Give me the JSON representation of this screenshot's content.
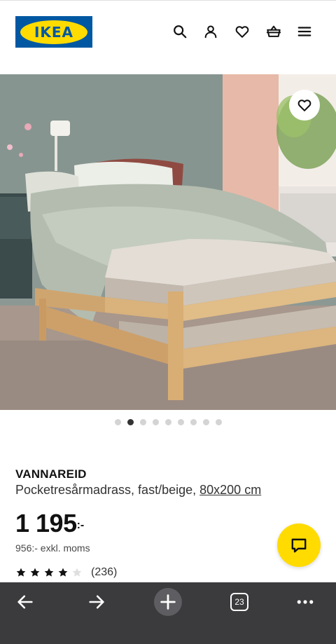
{
  "header": {
    "logo_text": "IKEA",
    "icons": [
      "search-icon",
      "account-icon",
      "favourites-icon",
      "basket-icon",
      "menu-icon"
    ]
  },
  "gallery": {
    "image_count": 9,
    "active_index": 1
  },
  "product": {
    "name": "VANNAREID",
    "description": "Pocketresårmadrass, fast/beige,",
    "size": "80x200 cm",
    "price": "1 195",
    "price_suffix": ":-",
    "price_ex_vat": "956:- exkl. moms",
    "rating": 4,
    "rating_max": 5,
    "rating_count": "(236)"
  },
  "browser_bar": {
    "tab_count": "23",
    "icons": [
      "back-arrow-icon",
      "forward-arrow-icon",
      "new-tab-icon",
      "tabs-icon",
      "more-icon"
    ]
  },
  "colors": {
    "ikea_blue": "#0058a3",
    "ikea_yellow": "#ffdb00",
    "browser_bar": "#3b3b3d"
  }
}
